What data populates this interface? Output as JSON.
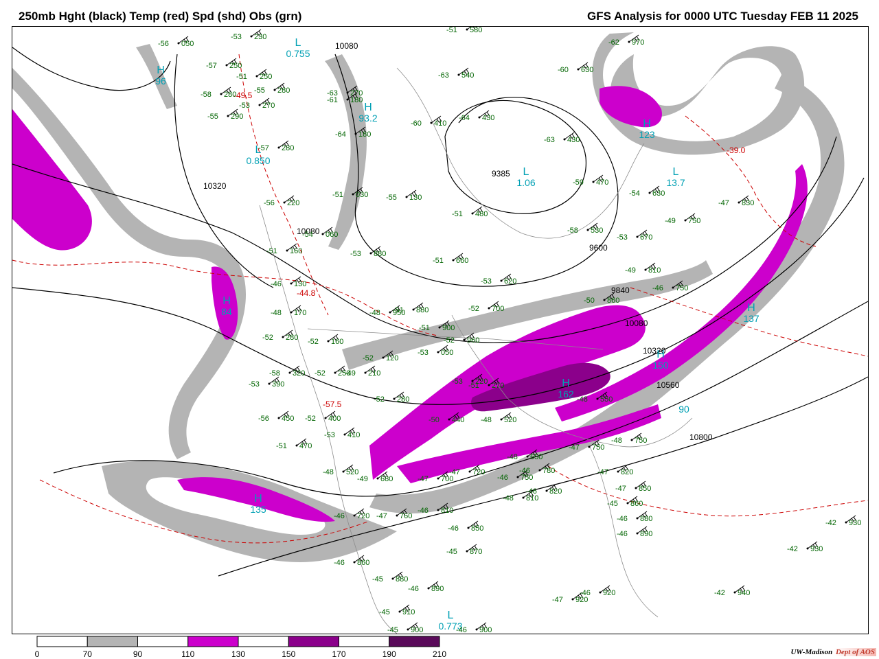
{
  "header": {
    "left": "250mb Hght (black) Temp (red) Spd (shd) Obs (grn)",
    "right": "GFS Analysis for 0000 UTC Tuesday  FEB 11 2025"
  },
  "colors": {
    "speed_70_90": "#b4b4b4",
    "speed_110_130": "#cc00cc",
    "speed_150_170": "#8b008b",
    "speed_190_210": "#5a0a5a",
    "height_contour": "#000000",
    "temperature_contour": "#cc0000",
    "observation": "#006400",
    "center_label": "#00a0b4"
  },
  "legend": {
    "labels": [
      "0",
      "70",
      "90",
      "110",
      "130",
      "150",
      "170",
      "190",
      "210"
    ],
    "bins": [
      {
        "from": 0,
        "to": 70,
        "color": "#ffffff"
      },
      {
        "from": 70,
        "to": 90,
        "color": "#b4b4b4"
      },
      {
        "from": 90,
        "to": 110,
        "color": "#ffffff"
      },
      {
        "from": 110,
        "to": 130,
        "color": "#cc00cc"
      },
      {
        "from": 130,
        "to": 150,
        "color": "#ffffff"
      },
      {
        "from": 150,
        "to": 170,
        "color": "#8b008b"
      },
      {
        "from": 170,
        "to": 190,
        "color": "#ffffff"
      },
      {
        "from": 190,
        "to": 210,
        "color": "#5a0a5a"
      }
    ]
  },
  "contour_labels": [
    "10080",
    "10320",
    "10080",
    "9385",
    "9600",
    "9840",
    "10080",
    "10320",
    "10560",
    "10800"
  ],
  "temperature_labels": [
    "-49.5",
    "-44.8",
    "-57.5",
    "-39.0"
  ],
  "centers": [
    {
      "letter": "L",
      "value": "0.755"
    },
    {
      "letter": "L",
      "value": "0.850"
    },
    {
      "letter": "L",
      "value": "1.06"
    },
    {
      "letter": "L",
      "value": "0.773"
    },
    {
      "letter": "H",
      "value": "96"
    },
    {
      "letter": "H",
      "value": "84"
    },
    {
      "letter": "H",
      "value": "93.2"
    },
    {
      "letter": "H",
      "value": "123"
    },
    {
      "letter": "L",
      "value": "13.7"
    },
    {
      "letter": "H",
      "value": "137"
    },
    {
      "letter": "H",
      "value": "162"
    },
    {
      "letter": "H",
      "value": "135"
    },
    {
      "letter": "H",
      "value": "150"
    },
    {
      "letter": "",
      "value": "90"
    }
  ],
  "observations": [
    {
      "temp": "-56",
      "height": "050"
    },
    {
      "temp": "-53",
      "height": "230"
    },
    {
      "temp": "-57",
      "height": "250"
    },
    {
      "temp": "-51",
      "height": "250"
    },
    {
      "temp": "-55",
      "height": "280"
    },
    {
      "temp": "-58",
      "height": "280"
    },
    {
      "temp": "-53",
      "height": "270"
    },
    {
      "temp": "-55",
      "height": "290"
    },
    {
      "temp": "-57",
      "height": "280"
    },
    {
      "temp": "-63",
      "height": "270"
    },
    {
      "temp": "-56",
      "height": "220"
    },
    {
      "temp": "-51",
      "height": "160"
    },
    {
      "temp": "-46",
      "height": "130"
    },
    {
      "temp": "-48",
      "height": "170"
    },
    {
      "temp": "-52",
      "height": "280"
    },
    {
      "temp": "-58",
      "height": "320"
    },
    {
      "temp": "-53",
      "height": "390"
    },
    {
      "temp": "-56",
      "height": "450"
    },
    {
      "temp": "-51",
      "height": "470"
    },
    {
      "temp": "-61",
      "height": "180"
    },
    {
      "temp": "-64",
      "height": "180"
    },
    {
      "temp": "-51",
      "height": "030"
    },
    {
      "temp": "-55",
      "height": "130"
    },
    {
      "temp": "-54",
      "height": "060"
    },
    {
      "temp": "-53",
      "height": "880"
    },
    {
      "temp": "-51",
      "height": "580"
    },
    {
      "temp": "-63",
      "height": "540"
    },
    {
      "temp": "-60",
      "height": "410"
    },
    {
      "temp": "-64",
      "height": "430"
    },
    {
      "temp": "-63",
      "height": "430"
    },
    {
      "temp": "-51",
      "height": "480"
    },
    {
      "temp": "-59",
      "height": "470"
    },
    {
      "temp": "-60",
      "height": "630"
    },
    {
      "temp": "-62",
      "height": "970"
    },
    {
      "temp": "-54",
      "height": "630"
    },
    {
      "temp": "-58",
      "height": "530"
    },
    {
      "temp": "-53",
      "height": "670"
    },
    {
      "temp": "-47",
      "height": "830"
    },
    {
      "temp": "-49",
      "height": "750"
    },
    {
      "temp": "-51",
      "height": "660"
    },
    {
      "temp": "-53",
      "height": "620"
    },
    {
      "temp": "-49",
      "height": "810"
    },
    {
      "temp": "-46",
      "height": "750"
    },
    {
      "temp": "-50",
      "height": "860"
    },
    {
      "temp": "-52",
      "height": "700"
    },
    {
      "temp": "-48",
      "height": "950"
    },
    {
      "temp": "-51",
      "height": "880"
    },
    {
      "temp": "-51",
      "height": "900"
    },
    {
      "temp": "-52",
      "height": "960"
    },
    {
      "temp": "-52",
      "height": "160"
    },
    {
      "temp": "-52",
      "height": "120"
    },
    {
      "temp": "-53",
      "height": "050"
    },
    {
      "temp": "-52",
      "height": "250"
    },
    {
      "temp": "-49",
      "height": "210"
    },
    {
      "temp": "-52",
      "height": "280"
    },
    {
      "temp": "-51",
      "height": "270"
    },
    {
      "temp": "-53",
      "height": "220"
    },
    {
      "temp": "-50",
      "height": "440"
    },
    {
      "temp": "-48",
      "height": "520"
    },
    {
      "temp": "-48",
      "height": "550"
    },
    {
      "temp": "-47",
      "height": "750"
    },
    {
      "temp": "-48",
      "height": "750"
    },
    {
      "temp": "-52",
      "height": "400"
    },
    {
      "temp": "-53",
      "height": "410"
    },
    {
      "temp": "-48",
      "height": "520"
    },
    {
      "temp": "-49",
      "height": "680"
    },
    {
      "temp": "-47",
      "height": "700"
    },
    {
      "temp": "-47",
      "height": "720"
    },
    {
      "temp": "-46",
      "height": "750"
    },
    {
      "temp": "-46",
      "height": "780"
    },
    {
      "temp": "-48",
      "height": "650"
    },
    {
      "temp": "-47",
      "height": "820"
    },
    {
      "temp": "-47",
      "height": "850"
    },
    {
      "temp": "-45",
      "height": "860"
    },
    {
      "temp": "-46",
      "height": "880"
    },
    {
      "temp": "-46",
      "height": "890"
    },
    {
      "temp": "-48",
      "height": "810"
    },
    {
      "temp": "-46",
      "height": "820"
    },
    {
      "temp": "-46",
      "height": "720"
    },
    {
      "temp": "-47",
      "height": "760"
    },
    {
      "temp": "-46",
      "height": "810"
    },
    {
      "temp": "-46",
      "height": "850"
    },
    {
      "temp": "-45",
      "height": "870"
    },
    {
      "temp": "-46",
      "height": "860"
    },
    {
      "temp": "-45",
      "height": "880"
    },
    {
      "temp": "-46",
      "height": "890"
    },
    {
      "temp": "-45",
      "height": "910"
    },
    {
      "temp": "-45",
      "height": "900"
    },
    {
      "temp": "-47",
      "height": "920"
    },
    {
      "temp": "-46",
      "height": "920"
    },
    {
      "temp": "-46",
      "height": "900"
    },
    {
      "temp": "-42",
      "height": "930"
    },
    {
      "temp": "-42",
      "height": "930"
    },
    {
      "temp": "-42",
      "height": "940"
    }
  ],
  "credit": {
    "org": "UW-Madison",
    "dept": "Dept of AOS"
  }
}
